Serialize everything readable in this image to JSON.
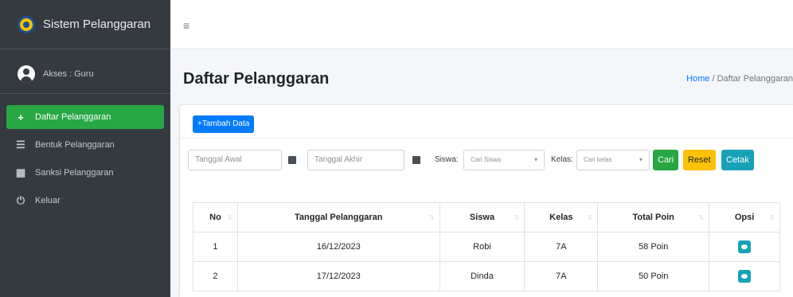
{
  "brand": {
    "title": "Sistem Pelanggaran",
    "logo_icon": "school-logo-icon"
  },
  "user": {
    "label": "Akses : Guru",
    "icon": "user-circle-icon"
  },
  "sidebar": {
    "items": [
      {
        "label": "Daftar Pelanggaran",
        "icon": "plus-icon",
        "glyph": "+",
        "active": true
      },
      {
        "label": "Bentuk Pelanggaran",
        "icon": "list-icon",
        "glyph": "☰",
        "active": false
      },
      {
        "label": "Sanksi Pelanggaran",
        "icon": "table-icon",
        "glyph": "▦",
        "active": false
      },
      {
        "label": "Keluar",
        "icon": "power-icon",
        "glyph": "⏻",
        "active": false
      }
    ]
  },
  "topbar": {
    "menu_icon": "≡"
  },
  "header": {
    "title": "Daftar Pelanggaran",
    "breadcrumb_home": "Home",
    "breadcrumb_sep": " / ",
    "breadcrumb_current": "Daftar Pelanggaran"
  },
  "card": {
    "add_label": "+Tambah Data"
  },
  "filters": {
    "start_date_placeholder": "Tanggal Awal",
    "end_date_placeholder": "Tanggal Akhir",
    "siswa_label": "Siswa:",
    "siswa_placeholder": "Cari Siswa",
    "kelas_label": "Kelas:",
    "kelas_placeholder": "Cari kelas",
    "cari_label": "Cari",
    "reset_label": "Reset",
    "cetak_label": "Cetak"
  },
  "table": {
    "columns": [
      "No",
      "Tanggal Pelanggaran",
      "Siswa",
      "Kelas",
      "Total Poin",
      "Opsi"
    ],
    "sort_glyph": "↑↓",
    "rows": [
      {
        "no": "1",
        "tanggal": "16/12/2023",
        "siswa": "Robi",
        "kelas": "7A",
        "poin": "58 Poin"
      },
      {
        "no": "2",
        "tanggal": "17/12/2023",
        "siswa": "Dinda",
        "kelas": "7A",
        "poin": "50 Poin"
      }
    ]
  },
  "colors": {
    "sidebar_bg": "#343a40",
    "active": "#28a745",
    "primary": "#007bff",
    "warning": "#ffc107",
    "info": "#17a2b8"
  }
}
